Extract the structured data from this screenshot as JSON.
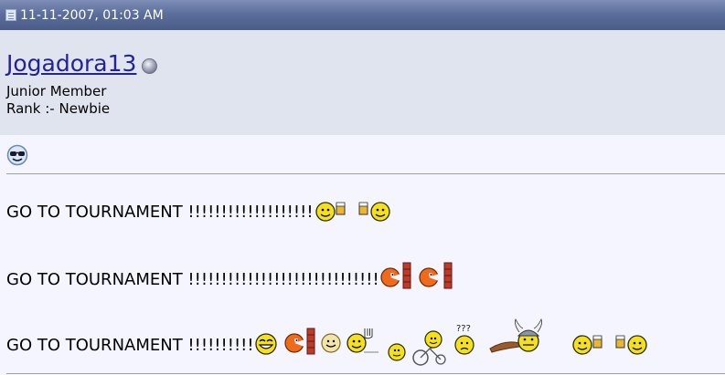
{
  "post": {
    "date": "11-11-2007, 01:03 AM",
    "username": "Jogadora13",
    "user_title": "Junior Member",
    "rank": "Rank :- Newbie",
    "lines": [
      "GO TO TOURNAMENT !!!!!!!!!!!!!!!!!!!",
      "GO TO TOURNAMENT !!!!!!!!!!!!!!!!!!!!!!!!!!!!!",
      "GO TO TOURNAMENT !!!!!!!!!!"
    ],
    "confused_smiley_text": "???"
  },
  "colors": {
    "header": "#5c6f9c",
    "user_panel": "#e0e4ef",
    "post_body": "#f5f5ff",
    "username_link": "#22229c"
  }
}
